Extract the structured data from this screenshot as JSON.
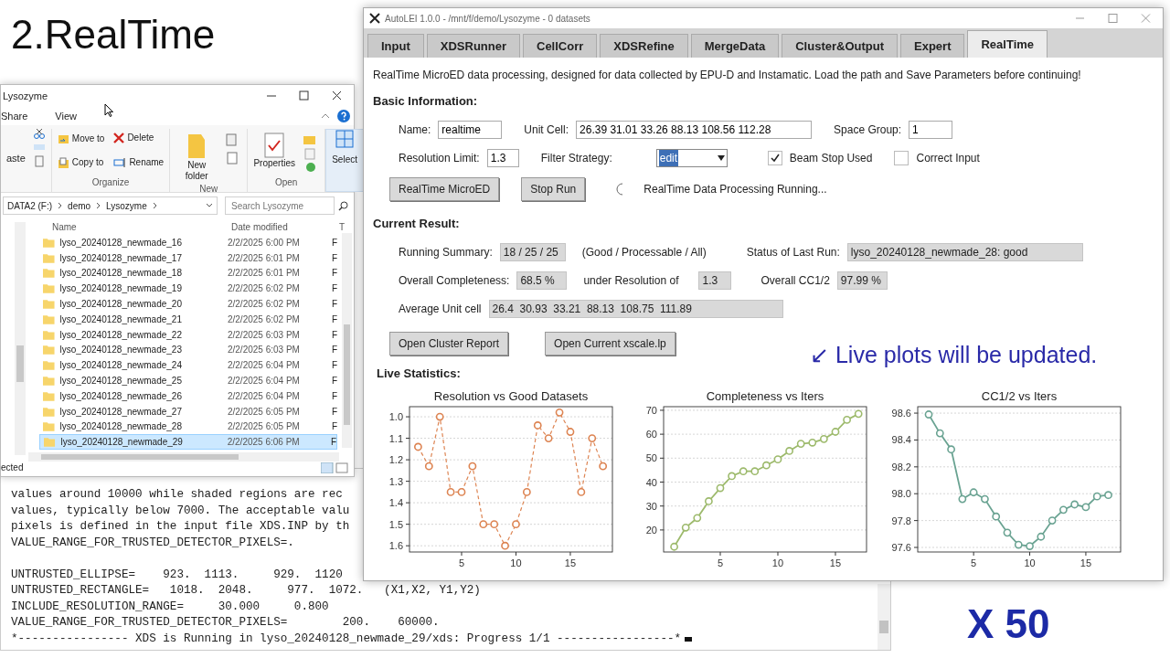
{
  "slide_title": "2.RealTime",
  "explorer": {
    "title": "Lysozyme",
    "menu": [
      "Share",
      "View"
    ],
    "ribbon": {
      "clipboard": "aste",
      "groups": [
        {
          "label": "Organize",
          "buttons": [
            {
              "kind": "move",
              "text": "Move to"
            },
            {
              "kind": "delete",
              "text": "Delete"
            },
            {
              "kind": "copy",
              "text": "Copy to"
            },
            {
              "kind": "rename",
              "text": "Rename"
            }
          ]
        },
        {
          "label": "New",
          "buttons": [
            {
              "kind": "folder",
              "text": "New folder"
            }
          ]
        },
        {
          "label": "Open",
          "buttons": [
            {
              "kind": "properties",
              "text": "Properties"
            }
          ]
        }
      ],
      "select": "Select"
    },
    "path": [
      "DATA2 (F:)",
      "demo",
      "Lysozyme"
    ],
    "search": {
      "placeholder": "Search Lysozyme"
    },
    "columns": [
      "Name",
      "Date modified",
      "T"
    ],
    "rows": [
      {
        "name": "lyso_20240128_newmade_16",
        "date": "2/2/2025 6:00 PM",
        "type": "F",
        "selected": false
      },
      {
        "name": "lyso_20240128_newmade_17",
        "date": "2/2/2025 6:01 PM",
        "type": "F",
        "selected": false
      },
      {
        "name": "lyso_20240128_newmade_18",
        "date": "2/2/2025 6:01 PM",
        "type": "F",
        "selected": false
      },
      {
        "name": "lyso_20240128_newmade_19",
        "date": "2/2/2025 6:02 PM",
        "type": "F",
        "selected": false
      },
      {
        "name": "lyso_20240128_newmade_20",
        "date": "2/2/2025 6:02 PM",
        "type": "F",
        "selected": false
      },
      {
        "name": "lyso_20240128_newmade_21",
        "date": "2/2/2025 6:02 PM",
        "type": "F",
        "selected": false
      },
      {
        "name": "lyso_20240128_newmade_22",
        "date": "2/2/2025 6:03 PM",
        "type": "F",
        "selected": false
      },
      {
        "name": "lyso_20240128_newmade_23",
        "date": "2/2/2025 6:03 PM",
        "type": "F",
        "selected": false
      },
      {
        "name": "lyso_20240128_newmade_24",
        "date": "2/2/2025 6:04 PM",
        "type": "F",
        "selected": false
      },
      {
        "name": "lyso_20240128_newmade_25",
        "date": "2/2/2025 6:04 PM",
        "type": "F",
        "selected": false
      },
      {
        "name": "lyso_20240128_newmade_26",
        "date": "2/2/2025 6:04 PM",
        "type": "F",
        "selected": false
      },
      {
        "name": "lyso_20240128_newmade_27",
        "date": "2/2/2025 6:05 PM",
        "type": "F",
        "selected": false
      },
      {
        "name": "lyso_20240128_newmade_28",
        "date": "2/2/2025 6:05 PM",
        "type": "F",
        "selected": false
      },
      {
        "name": "lyso_20240128_newmade_29",
        "date": "2/2/2025 6:06 PM",
        "type": "F",
        "selected": true
      }
    ],
    "status": "ected"
  },
  "terminal": {
    "lines": [
      "values around 10000 while shaded regions are rec",
      "values, typically below 7000. The acceptable valu",
      "pixels is defined in the input file XDS.INP by th",
      "VALUE_RANGE_FOR_TRUSTED_DETECTOR_PIXELS=.",
      "UNTRUSTED_ELLIPSE=    923.  1113.     929.  1120",
      "UNTRUSTED_RECTANGLE=   1018.  2048.     977.  1072.   (X1,X2, Y1,Y2)",
      "INCLUDE_RESOLUTION_RANGE=     30.000     0.800",
      "VALUE_RANGE_FOR_TRUSTED_DETECTOR_PIXELS=        200.    60000.",
      "*---------------- XDS is Running in lyso_20240128_newmade_29/xds: Progress 1/1 -----------------*"
    ]
  },
  "app": {
    "title": "AutoLEI 1.0.0 - /mnt/f/demo/Lysozyme - 0 datasets",
    "tabs": [
      {
        "label": "Input",
        "selected": false
      },
      {
        "label": "XDSRunner",
        "selected": false
      },
      {
        "label": "CellCorr",
        "selected": false
      },
      {
        "label": "XDSRefine",
        "selected": false
      },
      {
        "label": "MergeData",
        "selected": false
      },
      {
        "label": "Cluster&Output",
        "selected": false
      },
      {
        "label": "Expert",
        "selected": false
      },
      {
        "label": "RealTime",
        "selected": true
      }
    ],
    "intro": "RealTime MicroED data processing, designed for data collected by EPU-D and Instamatic. Load the path and Save Parameters before continuing!",
    "basic_heading": "Basic Information:",
    "basic_rows": [
      [
        {
          "kind": "input",
          "label": "Name:",
          "value": "realtime"
        },
        {
          "kind": "input",
          "label": "Unit Cell:",
          "value": "26.39 31.01 33.26 88.13 108.56 112.28"
        },
        {
          "kind": "input",
          "label": "Space Group:",
          "value": "1"
        }
      ],
      [
        {
          "kind": "input",
          "label": "Resolution Limit:",
          "value": "1.3"
        },
        {
          "kind": "select",
          "label": "Filter Strategy:",
          "value": "edit"
        },
        {
          "kind": "checkbox",
          "label": "Beam Stop Used",
          "checked": true
        },
        {
          "kind": "checkbox",
          "label": "Correct Input",
          "checked": false
        }
      ]
    ],
    "run_buttons": [
      "RealTime MicroED",
      "Stop Run"
    ],
    "run_status": "RealTime Data Processing Running...",
    "result_heading": "Current Result:",
    "result_rows": [
      [
        {
          "kind": "label",
          "text": "Running Summary:"
        },
        {
          "kind": "readout",
          "text": "18 / 25 / 25"
        },
        {
          "kind": "label",
          "text": "(Good / Processable / All)"
        },
        {
          "kind": "label",
          "text": "Status of Last Run:"
        },
        {
          "kind": "readout",
          "text": "lyso_20240128_newmade_28: good"
        }
      ],
      [
        {
          "kind": "label",
          "text": "Overall Completeness:"
        },
        {
          "kind": "readout",
          "text": "68.5 %"
        },
        {
          "kind": "label",
          "text": "under Resolution of"
        },
        {
          "kind": "readout",
          "text": "1.3"
        },
        {
          "kind": "label",
          "text": "Overall CC1/2"
        },
        {
          "kind": "readout",
          "text": "97.99 %"
        }
      ],
      [
        {
          "kind": "label",
          "text": "Average Unit cell"
        },
        {
          "kind": "readout",
          "text": "26.4  30.93  33.21  88.13  108.75  111.89"
        }
      ]
    ],
    "result_buttons": [
      "Open Cluster Report",
      "Open Current xscale.lp"
    ],
    "stats_heading": "Live Statistics:",
    "charts": [
      {
        "chart_data": {
          "type": "line",
          "title": "Resolution vs Good Datasets",
          "x": [
            1,
            2,
            3,
            4,
            5,
            6,
            7,
            8,
            9,
            10,
            11,
            12,
            13,
            14,
            15,
            16,
            17,
            18
          ],
          "grid": true,
          "series": [
            {
              "color": "#dd8452",
              "line_style": "dashed",
              "marker": "o",
              "values": [
                1.14,
                1.23,
                1.0,
                1.35,
                1.35,
                1.23,
                1.5,
                1.5,
                1.6,
                1.5,
                1.35,
                1.04,
                1.1,
                0.98,
                1.07,
                1.35,
                1.1,
                1.23
              ]
            }
          ],
          "xlim": [
            0.21,
            18.87
          ],
          "ylim": [
            1.629,
            0.953
          ],
          "xticks": [
            5,
            10,
            15
          ],
          "yticks": [
            {
              "value": 1.0,
              "label": "1.0"
            },
            1.1,
            1.2,
            1.3,
            1.4,
            1.5,
            1.6
          ]
        }
      },
      {
        "chart_data": {
          "type": "line",
          "title": "Completeness vs Iters",
          "x": [
            1,
            2,
            3,
            4,
            5,
            6,
            7,
            8,
            9,
            10,
            11,
            12,
            13,
            14,
            15,
            16,
            17
          ],
          "grid": true,
          "series": [
            {
              "color": "#9dba6c",
              "line_style": "solid",
              "marker": "o",
              "values": [
                13,
                21,
                25,
                32,
                37.5,
                42.5,
                44.5,
                44.5,
                47,
                49.5,
                53,
                56,
                56.5,
                58,
                61,
                66,
                68.5
              ]
            }
          ],
          "xlim": [
            0.08,
            17.7
          ],
          "ylim": [
            10.8,
            71.5
          ],
          "xticks": [
            5,
            10,
            15
          ],
          "yticks": [
            20,
            30,
            40,
            50,
            60,
            70
          ]
        }
      },
      {
        "chart_data": {
          "type": "line",
          "title": "CC1/2 vs Iters",
          "x": [
            1,
            2,
            3,
            4,
            5,
            6,
            7,
            8,
            9,
            10,
            11,
            12,
            13,
            14,
            15,
            16,
            17
          ],
          "grid": true,
          "series": [
            {
              "color": "#6aa392",
              "line_style": "solid",
              "marker": "o",
              "values": [
                98.59,
                98.45,
                98.33,
                97.96,
                98.01,
                97.96,
                97.83,
                97.71,
                97.62,
                97.61,
                97.68,
                97.8,
                97.88,
                97.92,
                97.9,
                97.98,
                97.99
              ]
            }
          ],
          "xlim": [
            0.02,
            18.1
          ],
          "ylim": [
            97.566,
            98.648
          ],
          "xticks": [
            5,
            10,
            15
          ],
          "yticks": [
            97.6,
            97.8,
            {
              "value": 98.0,
              "label": "98.0"
            },
            98.2,
            98.4,
            98.6
          ]
        }
      }
    ]
  },
  "annotation": "↙ Live plots will be updated.",
  "multiplier": "X 50"
}
